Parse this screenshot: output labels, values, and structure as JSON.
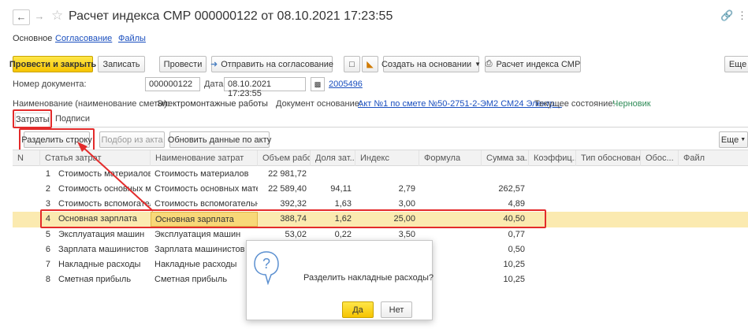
{
  "window": {
    "title": "Расчет индекса СМР 000000122 от 08.10.2021 17:23:55"
  },
  "nav": {
    "tabs": [
      "Основное",
      "Согласование",
      "Файлы"
    ]
  },
  "toolbar": {
    "post_close": "Провести и закрыть",
    "save": "Записать",
    "post": "Провести",
    "send_approval": "Отправить на согласование",
    "create_based": "Создать на основании",
    "print_index": "Расчет индекса СМР",
    "more": "Еще"
  },
  "form": {
    "doc_number_label": "Номер документа:",
    "doc_number": "000000122",
    "date_label": "Дата:",
    "date": "08.10.2021 17:23:55",
    "date_link": "2005496",
    "name_label": "Наименование (наименование сметы):",
    "name": "Электромонтажные работы",
    "basis_label": "Документ основание:",
    "basis": "Акт №1 по смете №50-2751-2-ЭМ2 СМ24 Электр...",
    "state_label": "Текущее состояние:",
    "state": "Черновик"
  },
  "subtabs": [
    "Затраты",
    "Подписи"
  ],
  "grid_toolbar": {
    "split": "Разделить строку",
    "select_act": "Подбор из акта",
    "update": "Обновить данные по акту",
    "more": "Еще"
  },
  "table": {
    "columns": [
      "N",
      "Статья затрат",
      "Наименование затрат",
      "Объем рабо...",
      "Доля зат...",
      "Индекс",
      "Формула",
      "Сумма за...",
      "Коэффиц...",
      "Тип обоснования",
      "Обос...",
      "Файл"
    ],
    "rows": [
      {
        "n": "1",
        "article": "Стоимость материалов",
        "name": "Стоимость материалов",
        "volume": "22 981,72",
        "share": "",
        "index": "",
        "formula": "",
        "sum": ""
      },
      {
        "n": "2",
        "article": "Стоимость основных м...",
        "name": "Стоимость основных матери...",
        "volume": "22 589,40",
        "share": "94,11",
        "index": "2,79",
        "formula": "",
        "sum": "262,57"
      },
      {
        "n": "3",
        "article": "Стоимость вспомогател...",
        "name": "Стоимость вспомогательных ...",
        "volume": "392,32",
        "share": "1,63",
        "index": "3,00",
        "formula": "",
        "sum": "4,89"
      },
      {
        "n": "4",
        "article": "Основная зарплата",
        "name": "Основная зарплата",
        "volume": "388,74",
        "share": "1,62",
        "index": "25,00",
        "formula": "",
        "sum": "40,50"
      },
      {
        "n": "5",
        "article": "Эксплуатация машин",
        "name": "Эксплуатация машин",
        "volume": "53,02",
        "share": "0,22",
        "index": "3,50",
        "formula": "",
        "sum": "0,77"
      },
      {
        "n": "6",
        "article": "Зарплата машинистов",
        "name": "Зарплата машинистов",
        "volume": "",
        "share": "",
        "index": "",
        "formula": "",
        "sum": "0,50"
      },
      {
        "n": "7",
        "article": "Накладные расходы",
        "name": "Накладные расходы",
        "volume": "",
        "share": "",
        "index": "",
        "formula": "",
        "sum": "10,25"
      },
      {
        "n": "8",
        "article": "Сметная прибыль",
        "name": "Сметная прибыль",
        "volume": "",
        "share": "",
        "index": "",
        "formula": "",
        "sum": "10,25"
      }
    ]
  },
  "dialog": {
    "icon": "question-icon",
    "message": "Разделить накладные расходы?",
    "yes": "Да",
    "no": "Нет"
  },
  "colors": {
    "accent_yellow": "#f6c400",
    "selected_row": "#fbeab0",
    "annotation_red": "#e32b2b",
    "link_blue": "#1a4fbf",
    "state_green": "#2e8b57"
  }
}
